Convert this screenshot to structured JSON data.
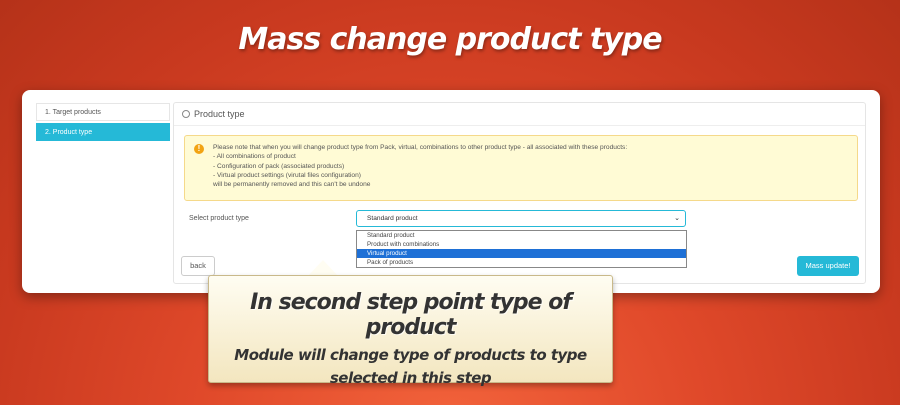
{
  "headline": "Mass change product type",
  "sidebar": {
    "items": [
      {
        "label": "1. Target products",
        "active": false
      },
      {
        "label": "2. Product type",
        "active": true
      }
    ]
  },
  "panel": {
    "title": "Product type",
    "alert": {
      "lines": [
        "Please note that when you will change product type from Pack, virtual, combinations to other product type - all associated with these products:",
        "- All combinations of product",
        "- Configuration of pack (associated products)",
        "- Virtual product settings (virutal files configuration)",
        "will be permanently removed and this can't be undone"
      ]
    },
    "select": {
      "label": "Select product type",
      "value": "Standard product",
      "options": [
        "Standard product",
        "Product with combinations",
        "Virtual product",
        "Pack of products"
      ],
      "highlighted": "Virtual product"
    },
    "buttons": {
      "back": "back",
      "submit": "Mass update!"
    }
  },
  "callout": {
    "title": "In second step point type of product",
    "body": "Module will change type of products to type selected in this step"
  },
  "colors": {
    "accent": "#25b9d7",
    "highlight": "#1e70d6",
    "alert_bg": "#fffbd5",
    "warning": "#f2a313"
  }
}
